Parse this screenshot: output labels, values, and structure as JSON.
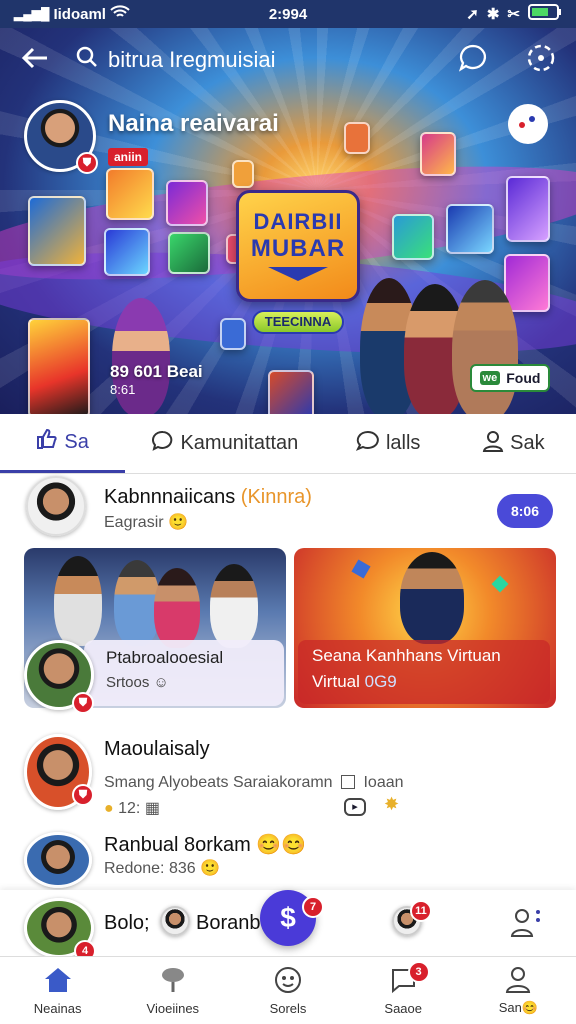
{
  "status": {
    "carrier": "Iidoaml",
    "time": "2:994"
  },
  "header": {
    "search_title": "bitrua Iregmuisiai"
  },
  "hero": {
    "profile_name": "Naina reaivarai",
    "promo_tag": "aniin",
    "logo_line1": "DAIRBII",
    "logo_line2": "MUBAR",
    "logo_button": "TEECINNA",
    "viewers": "89 601 Beai",
    "viewers_sub": "8:61",
    "cta": "Foud",
    "cta_icon": "we"
  },
  "tabs": [
    {
      "label": "Sa",
      "icon": "thumbs-up-icon"
    },
    {
      "label": "Kamunitattan",
      "icon": "chat-bubble-icon"
    },
    {
      "label": "lalls",
      "icon": "chat-bubble-icon"
    },
    {
      "label": "Sak",
      "icon": "user-icon"
    }
  ],
  "feed": {
    "post1": {
      "name": "Kabnnnaiicans",
      "tag": "(Kinnra)",
      "sub": "Eagrasir",
      "button": "8:06"
    },
    "card1": {
      "title": "Ptabroalooesial",
      "sub": "Srtoos"
    },
    "card2": {
      "title": "Seana Kanhhans Virtuan",
      "sub": "Virtual",
      "sub_code": "0G9"
    },
    "post2": {
      "name": "Maoulaisaly",
      "sub": "Smang Alyobeats Saraiakoramn",
      "tag": "Ioaan",
      "meta": "12:"
    },
    "post3": {
      "name": "Ranbual 8orkam",
      "sub": "Redone: 836"
    },
    "story": {
      "label": "Bolo;",
      "label2": "Boranb",
      "fab_badge": "7",
      "badge2": "11"
    }
  },
  "bottom_nav": [
    {
      "label": "Neainas",
      "icon": "home-icon"
    },
    {
      "label": "Vioeiines",
      "icon": "microphone-icon"
    },
    {
      "label": "Sorels",
      "icon": "face-icon"
    },
    {
      "label": "Saaoe",
      "icon": "chat-icon",
      "badge": "3"
    },
    {
      "label": "San",
      "icon": "user-icon"
    }
  ],
  "colors": {
    "accent": "#3a3fa8",
    "badge": "#d8202c",
    "status_bar": "#20356b"
  }
}
